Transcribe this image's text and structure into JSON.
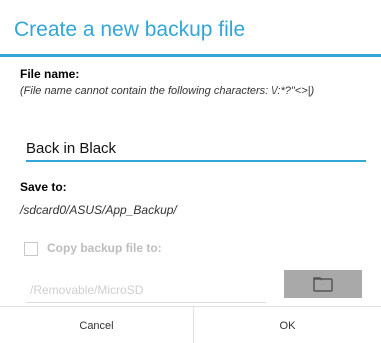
{
  "dialog": {
    "title": "Create a new backup file",
    "file_name_label": "File name:",
    "file_name_hint": "(File name cannot contain the following characters: \\/:*?\"<>|)",
    "file_name_value": "Back in Black",
    "save_to_label": "Save to:",
    "save_to_path": "/sdcard0/ASUS/App_Backup/",
    "copy_checkbox_label": "Copy backup file to:",
    "copy_checkbox_checked": false,
    "copy_destination_path": "/Removable/MicroSD",
    "folder_button_icon": "folder-icon",
    "cancel_label": "Cancel",
    "ok_label": "OK"
  },
  "colors": {
    "accent": "#33a6d8",
    "disabled_text": "#bdbdbd",
    "folder_button_bg": "#a9a9a9"
  }
}
